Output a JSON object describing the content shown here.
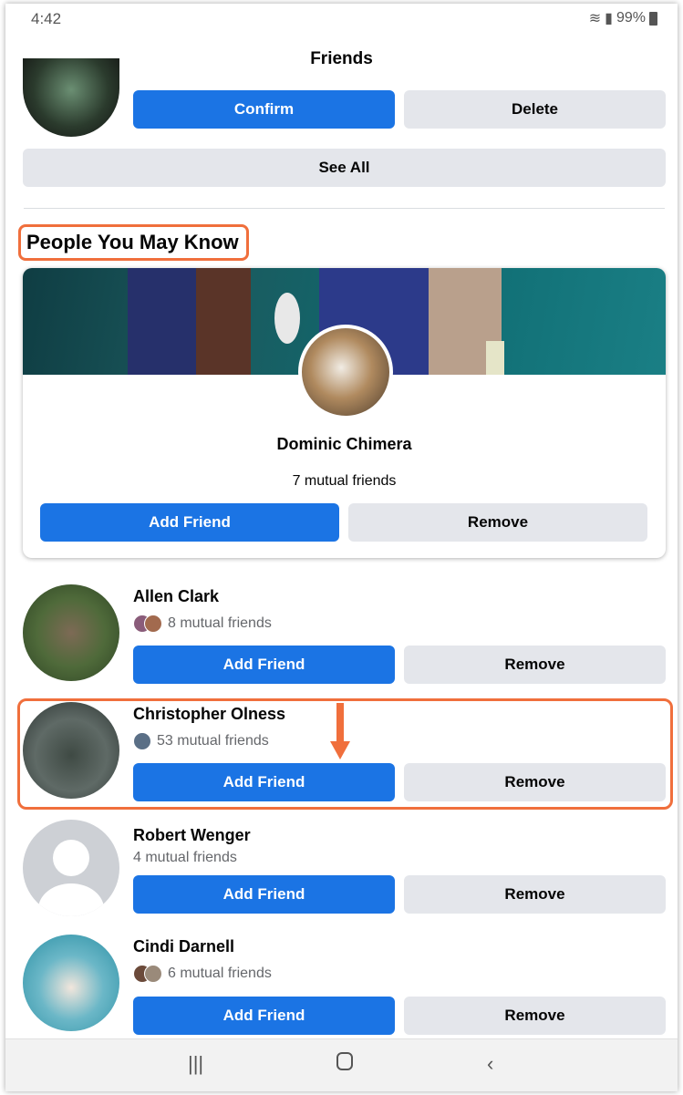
{
  "status_bar": {
    "time": "4:42",
    "battery": "99%"
  },
  "header": {
    "title": "Friends"
  },
  "request": {
    "confirm_label": "Confirm",
    "delete_label": "Delete"
  },
  "see_all_label": "See All",
  "section_title": "People You May Know",
  "featured": {
    "name": "Dominic Chimera",
    "mutual": "7 mutual friends",
    "add_label": "Add Friend",
    "remove_label": "Remove"
  },
  "people": [
    {
      "name": "Allen Clark",
      "mutual": "8 mutual friends",
      "add_label": "Add Friend",
      "remove_label": "Remove"
    },
    {
      "name": "Christopher Olness",
      "mutual": "53 mutual friends",
      "add_label": "Add Friend",
      "remove_label": "Remove"
    },
    {
      "name": "Robert Wenger",
      "mutual": "4 mutual friends",
      "add_label": "Add Friend",
      "remove_label": "Remove"
    },
    {
      "name": "Cindi Darnell",
      "mutual": "6 mutual friends",
      "add_label": "Add Friend",
      "remove_label": "Remove"
    }
  ],
  "colors": {
    "primary": "#1b74e4",
    "secondary_button": "#e4e6eb",
    "highlight": "#f06f3c"
  }
}
